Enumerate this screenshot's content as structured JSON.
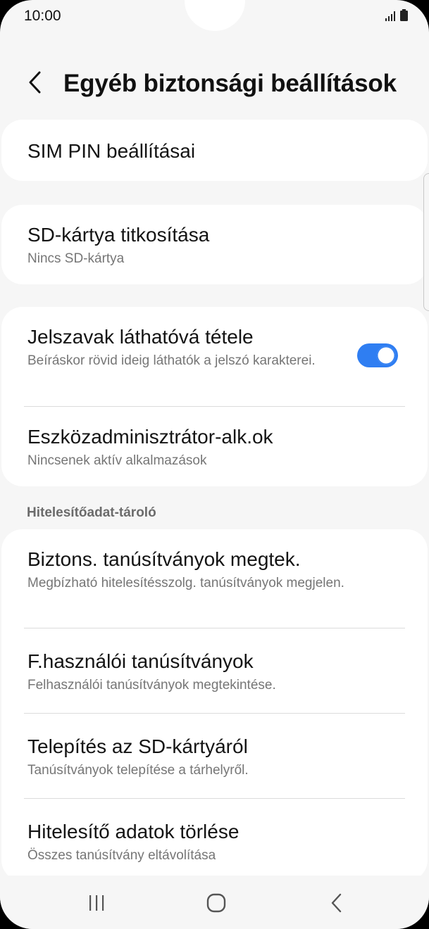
{
  "status_bar": {
    "time": "10:00"
  },
  "header": {
    "title": "Egyéb biztonsági beállítások",
    "back_icon": "chevron-left-icon"
  },
  "cards": {
    "sim_pin": {
      "title": "SIM PIN beállításai"
    },
    "sd_encrypt": {
      "title": "SD-kártya titkosítása",
      "subtitle": "Nincs SD-kártya"
    },
    "passwords": {
      "title": "Jelszavak láthatóvá tétele",
      "subtitle": "Beíráskor rövid ideig láthatók a jelszó karakterei.",
      "toggle_on": true
    },
    "device_admin": {
      "title": "Eszközadminisztrátor-alk.ok",
      "subtitle": "Nincsenek aktív alkalmazások"
    }
  },
  "credential_storage": {
    "label": "Hitelesítőadat-tároló",
    "items": [
      {
        "title": "Biztons. tanúsítványok megtek.",
        "subtitle": "Megbízható hitelesítésszolg. tanúsítványok megjelen."
      },
      {
        "title": "F.használói tanúsítványok",
        "subtitle": "Felhasználói tanúsítványok megtekintése."
      },
      {
        "title": "Telepítés az SD-kártyáról",
        "subtitle": "Tanúsítványok telepítése a tárhelyről."
      },
      {
        "title": "Hitelesítő adatok törlése",
        "subtitle": "Összes tanúsítvány eltávolítása"
      }
    ]
  },
  "colors": {
    "accent": "#2f7ef2",
    "background": "#f6f6f6",
    "card": "#ffffff"
  }
}
